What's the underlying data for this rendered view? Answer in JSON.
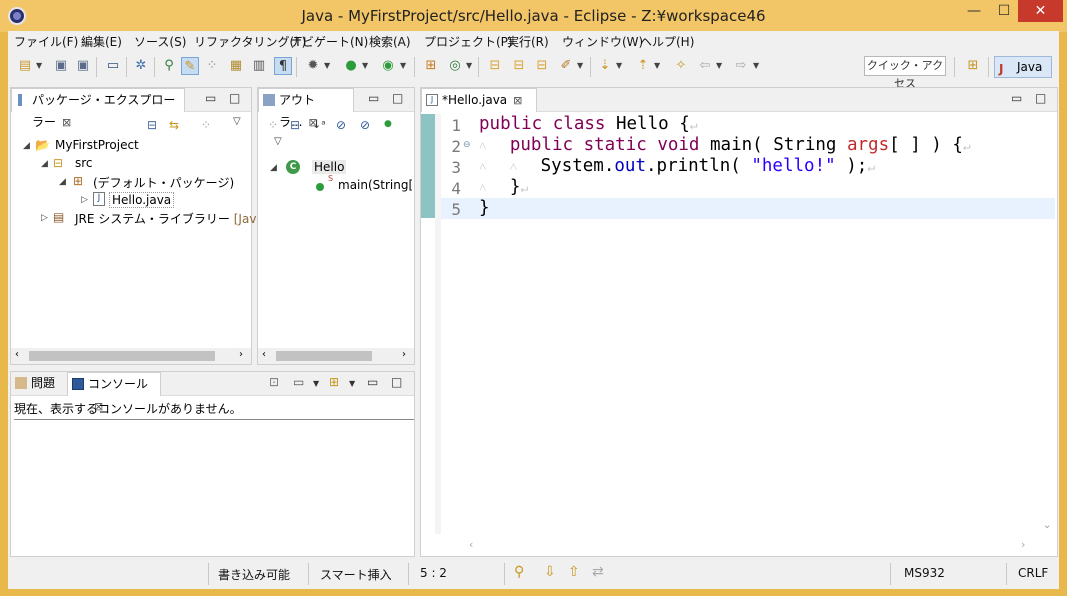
{
  "window": {
    "title": "Java - MyFirstProject/src/Hello.java - Eclipse - Z:¥workspace46",
    "minimize": "—",
    "maximize": "☐",
    "close": "✕"
  },
  "menu": [
    "ファイル(F)",
    "編集(E)",
    "ソース(S)",
    "リファクタリング(T)",
    "ナビゲート(N)",
    "検索(A)",
    "プロジェクト(P)",
    "実行(R)",
    "ウィンドウ(W)",
    "ヘルプ(H)"
  ],
  "toolbar": {
    "quick_access": "クイック・アクセス",
    "perspective": "Java"
  },
  "package_explorer": {
    "tab": "パッケージ・エクスプローラー",
    "close": "⊠",
    "project": "MyFirstProject",
    "src": "src",
    "package": "(デフォルト・パッケージ)",
    "file": "Hello.java",
    "jre": "JRE システム・ライブラリー",
    "jre_suffix": "[JavaSE-"
  },
  "outline": {
    "tab": "アウトラ...",
    "close": "⊠",
    "class": "Hello",
    "method": "main(String["
  },
  "console_area": {
    "problems_tab": "問題",
    "console_tab": "コンソール",
    "close": "⊠",
    "message": "現在、表示するコンソールがありません。"
  },
  "editor": {
    "tab": "*Hello.java",
    "close": "⊠",
    "line_numbers": [
      "1",
      "2",
      "3",
      "4",
      "5"
    ],
    "lines": {
      "l1_kw": "public class",
      "l1_rest": " Hello {",
      "l2_kw": "public static void",
      "l2_a": " main( String ",
      "l2_var": "args",
      "l2_b": "[ ] ) {",
      "l3_a": "System.",
      "l3_fld": "out",
      "l3_b": ".println( ",
      "l3_str": "\"hello!\"",
      "l3_c": " );",
      "l4": "}",
      "l5": "}"
    }
  },
  "status": {
    "writable": "書き込み可能",
    "insert_mode": "スマート挿入",
    "position": "5 : 2",
    "encoding": "MS932",
    "line_delim": "CRLF"
  },
  "colors": {
    "title_bar": "#f2c566",
    "close_button": "#c7392b",
    "keyword": "#7f0055",
    "string": "#2a00ff",
    "field": "#0000c0",
    "current_line": "#e8f2fe"
  }
}
